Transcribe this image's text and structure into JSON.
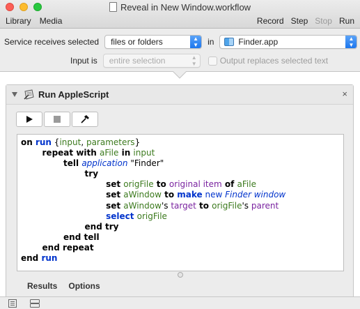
{
  "window": {
    "title": "Reveal in New Window.workflow"
  },
  "menu": {
    "library": "Library",
    "media": "Media"
  },
  "toolbar": {
    "record": "Record",
    "step": "Step",
    "stop": "Stop",
    "run": "Run"
  },
  "settings": {
    "receives_label": "Service receives selected",
    "receives_value": "files or folders",
    "in_label": "in",
    "in_value": "Finder.app",
    "input_label": "Input is",
    "input_value": "entire selection",
    "replace_label": "Output replaces selected text"
  },
  "action": {
    "title": "Run AppleScript",
    "close": "×",
    "code_lines": [
      {
        "parts": [
          [
            "kw",
            "on "
          ],
          [
            "cmd",
            "run"
          ],
          [
            "str",
            " {"
          ],
          [
            "var",
            "input"
          ],
          [
            "str",
            ", "
          ],
          [
            "var",
            "parameters"
          ],
          [
            "str",
            "}"
          ]
        ]
      },
      {
        "parts": [
          [
            "str",
            "        "
          ],
          [
            "kw",
            "repeat with "
          ],
          [
            "var",
            "aFile"
          ],
          [
            "kw",
            " in "
          ],
          [
            "var",
            "input"
          ]
        ]
      },
      {
        "parts": [
          [
            "str",
            "                "
          ],
          [
            "kw",
            "tell "
          ],
          [
            "app",
            "application"
          ],
          [
            "str",
            " \"Finder\""
          ]
        ]
      },
      {
        "parts": [
          [
            "str",
            "                        "
          ],
          [
            "kw",
            "try"
          ]
        ]
      },
      {
        "parts": [
          [
            "str",
            "                                "
          ],
          [
            "kw",
            "set "
          ],
          [
            "var",
            "origFile"
          ],
          [
            "kw",
            " to "
          ],
          [
            "prop",
            "original item"
          ],
          [
            "kw",
            " of "
          ],
          [
            "var",
            "aFile"
          ]
        ]
      },
      {
        "parts": [
          [
            "str",
            "                                "
          ],
          [
            "kw",
            "set "
          ],
          [
            "var",
            "aWindow"
          ],
          [
            "kw",
            " to "
          ],
          [
            "cmd",
            "make"
          ],
          [
            "cmd2",
            " new "
          ],
          [
            "app",
            "Finder window"
          ]
        ]
      },
      {
        "parts": [
          [
            "str",
            "                                "
          ],
          [
            "kw",
            "set "
          ],
          [
            "var",
            "aWindow"
          ],
          [
            "str",
            "'s "
          ],
          [
            "prop",
            "target"
          ],
          [
            "kw",
            " to "
          ],
          [
            "var",
            "origFile"
          ],
          [
            "str",
            "'s "
          ],
          [
            "prop",
            "parent"
          ]
        ]
      },
      {
        "parts": [
          [
            "str",
            "                                "
          ],
          [
            "cmd",
            "select "
          ],
          [
            "var",
            "origFile"
          ]
        ]
      },
      {
        "parts": [
          [
            "str",
            "                        "
          ],
          [
            "kw",
            "end try"
          ]
        ]
      },
      {
        "parts": [
          [
            "str",
            "                "
          ],
          [
            "kw",
            "end tell"
          ]
        ]
      },
      {
        "parts": [
          [
            "str",
            "        "
          ],
          [
            "kw",
            "end repeat"
          ]
        ]
      },
      {
        "parts": [
          [
            "kw",
            "end "
          ],
          [
            "cmd",
            "run"
          ]
        ]
      }
    ],
    "tabs": [
      "Results",
      "Options"
    ]
  },
  "colors": {
    "keyword": "#000000",
    "command": "#0033cc",
    "variable": "#3c7a1e",
    "property": "#7a23a0"
  }
}
